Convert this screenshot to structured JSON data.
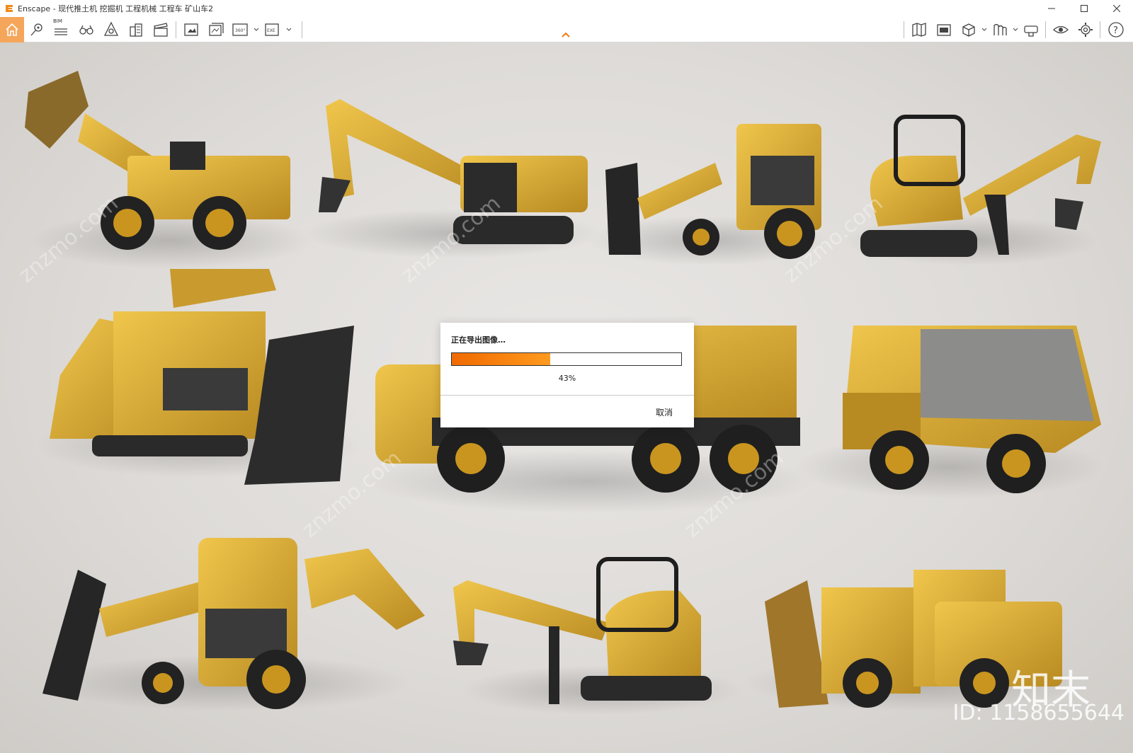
{
  "window": {
    "app_name": "Enscape",
    "title": "Enscape - 现代推土机 挖掘机 工程机械 工程车 矿山车2",
    "controls": [
      "minimize",
      "maximize",
      "close"
    ]
  },
  "toolbar": {
    "bim_label": "BIM",
    "left_icons": [
      "home-icon",
      "location-pin-icon",
      "bim-list-icon",
      "binoculars-icon",
      "atmosphere-icon",
      "buildings-icon",
      "video-editor-icon",
      "screenshot-icon",
      "batch-render-icon",
      "panorama-360-icon",
      "exe-export-icon"
    ],
    "right_icons": [
      "map-icon",
      "material-editor-icon",
      "asset-library-icon",
      "views-icon",
      "vr-headset-icon",
      "visual-settings-icon",
      "settings-icon",
      "help-icon"
    ],
    "panorama_label": "360°",
    "exe_label": "EXE"
  },
  "viewport": {
    "watermark_site": "znzmo.com",
    "watermark_brand": "知末",
    "watermark_id": "ID: 1158655644"
  },
  "dialog": {
    "title": "正在导出图像…",
    "progress": 0.43,
    "progress_label": "43%",
    "cancel_label": "取消"
  },
  "colors": {
    "accent": "#f5a65b",
    "progress_fill": "#f06a00",
    "machine_yellow": "#d9a933"
  }
}
